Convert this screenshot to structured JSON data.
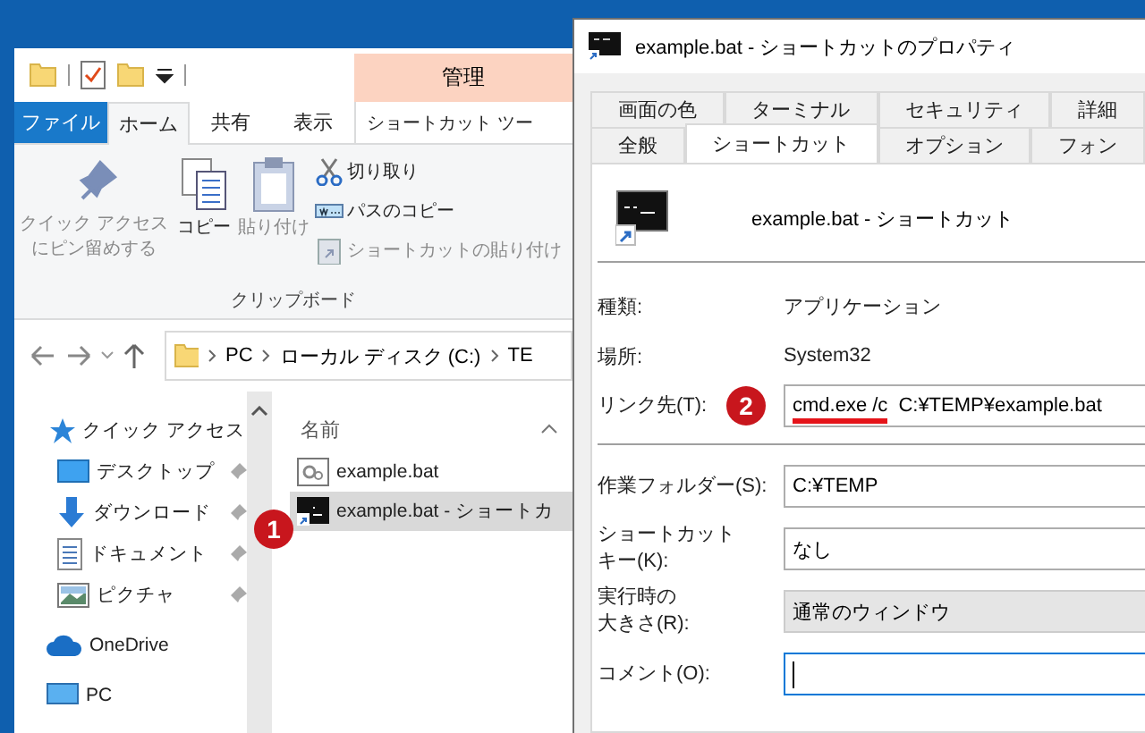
{
  "explorer": {
    "context_tab": "管理",
    "ribbon_tabs": [
      {
        "label": "ファイル",
        "kind": "file",
        "selected": false
      },
      {
        "label": "ホーム",
        "kind": "tab",
        "selected": true
      },
      {
        "label": "共有",
        "kind": "tab",
        "selected": false
      },
      {
        "label": "表示",
        "kind": "tab",
        "selected": false
      },
      {
        "label": "ショートカット ツー",
        "kind": "context",
        "selected": false
      }
    ],
    "large_buttons": [
      {
        "label": "クイック アクセスにピン留めする",
        "kind": "pin",
        "disabled": true
      },
      {
        "label": "コピー",
        "kind": "copy",
        "disabled": false
      },
      {
        "label": "貼り付け",
        "kind": "paste",
        "disabled": true
      }
    ],
    "small_buttons": [
      {
        "label": "切り取り",
        "kind": "cut",
        "disabled": false
      },
      {
        "label": "パスのコピー",
        "kind": "copy-path",
        "disabled": false
      },
      {
        "label": "ショートカットの貼り付け",
        "kind": "paste-shortcut",
        "disabled": true
      }
    ],
    "group_label": "クリップボード",
    "address": [
      "PC",
      "ローカル ディスク (C:)",
      "TE"
    ],
    "nav_items": [
      {
        "label": "クイック アクセス",
        "kind": "quick-access",
        "pinned": false
      },
      {
        "label": "デスクトップ",
        "kind": "desktop",
        "pinned": true
      },
      {
        "label": "ダウンロード",
        "kind": "download",
        "pinned": true
      },
      {
        "label": "ドキュメント",
        "kind": "document",
        "pinned": true
      },
      {
        "label": "ピクチャ",
        "kind": "picture",
        "pinned": true
      },
      {
        "label": "OneDrive",
        "kind": "cloud",
        "pinned": false
      },
      {
        "label": "PC",
        "kind": "pc",
        "pinned": false
      }
    ],
    "column_header": "名前",
    "files": [
      {
        "name": "example.bat",
        "kind": "batch",
        "selected": false
      },
      {
        "name": "example.bat - ショートカ",
        "kind": "shortcut",
        "selected": true
      }
    ],
    "badge": "1"
  },
  "dialog": {
    "title": "example.bat - ショートカットのプロパティ",
    "tab_rows": [
      [
        {
          "label": "画面の色",
          "selected": false
        },
        {
          "label": "ターミナル",
          "selected": false
        },
        {
          "label": "セキュリティ",
          "selected": false
        },
        {
          "label": "詳細",
          "selected": false
        }
      ],
      [
        {
          "label": "全般",
          "selected": false
        },
        {
          "label": "ショートカット",
          "selected": true
        },
        {
          "label": "オプション",
          "selected": false
        },
        {
          "label": "フォン",
          "selected": false
        }
      ]
    ],
    "name": "example.bat - ショートカット",
    "info": [
      {
        "label": "種類:",
        "value": "アプリケーション"
      },
      {
        "label": "場所:",
        "value": "System32"
      }
    ],
    "target": {
      "label_lines": [
        "リンク先(T):"
      ],
      "badge": "2",
      "parts": [
        {
          "text": "cmd.exe /c",
          "underlined": true
        },
        {
          "text": "C:¥TEMP¥example.bat",
          "underlined": false
        }
      ]
    },
    "fields": [
      {
        "label_lines": [
          "作業フォルダー(S):"
        ],
        "value": "C:¥TEMP",
        "kind": "text",
        "focused": false
      },
      {
        "label_lines": [
          "ショートカット",
          "キー(K):"
        ],
        "value": "なし",
        "kind": "text",
        "focused": false
      },
      {
        "label_lines": [
          "実行時の",
          "大きさ(R):"
        ],
        "value": "通常のウィンドウ",
        "kind": "dropdown",
        "focused": false
      },
      {
        "label_lines": [
          "コメント(O):"
        ],
        "kind": "text",
        "focused": true
      }
    ]
  }
}
